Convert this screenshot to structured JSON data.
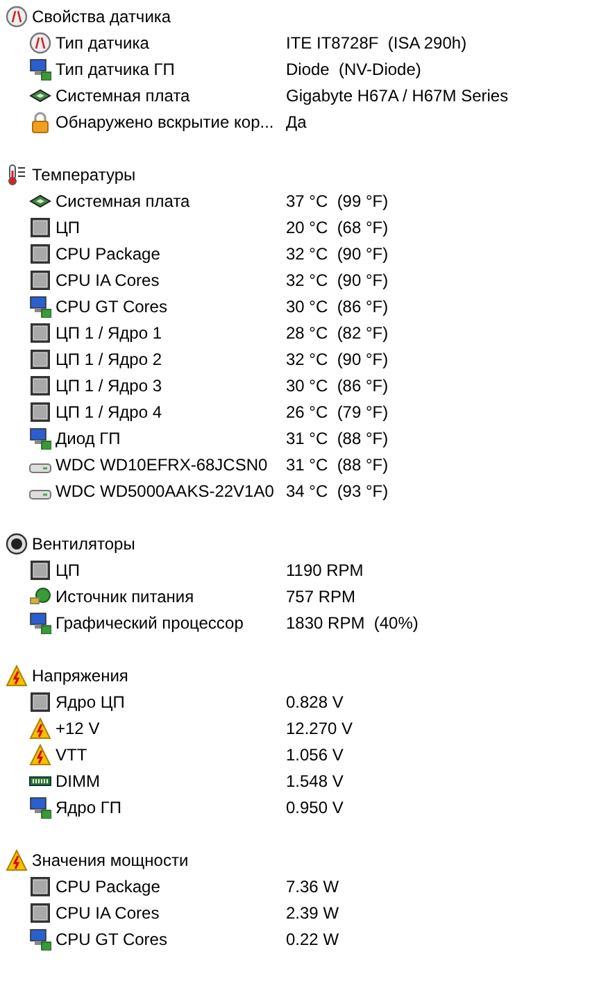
{
  "sections": [
    {
      "title": "Свойства датчика",
      "kind": "gauge",
      "items": [
        {
          "kind": "gauge",
          "label": "Тип датчика",
          "value": "ITE IT8728F  (ISA 290h)"
        },
        {
          "kind": "gpu",
          "label": "Тип датчика ГП",
          "value": "Diode  (NV-Diode)"
        },
        {
          "kind": "board",
          "label": "Системная плата",
          "value": "Gigabyte H67A / H67M Series"
        },
        {
          "kind": "lock",
          "label": "Обнаружено вскрытие кор...",
          "value": "Да"
        }
      ]
    },
    {
      "title": "Температуры",
      "kind": "thermo",
      "items": [
        {
          "kind": "board",
          "label": "Системная плата",
          "value": "37 °C  (99 °F)"
        },
        {
          "kind": "cpu",
          "label": "ЦП",
          "value": "20 °C  (68 °F)"
        },
        {
          "kind": "cpu",
          "label": "CPU Package",
          "value": "32 °C  (90 °F)"
        },
        {
          "kind": "cpu",
          "label": "CPU IA Cores",
          "value": "32 °C  (90 °F)"
        },
        {
          "kind": "gpu",
          "label": "CPU GT Cores",
          "value": "30 °C  (86 °F)"
        },
        {
          "kind": "cpu",
          "label": "ЦП 1 / Ядро 1",
          "value": "28 °C  (82 °F)"
        },
        {
          "kind": "cpu",
          "label": "ЦП 1 / Ядро 2",
          "value": "32 °C  (90 °F)"
        },
        {
          "kind": "cpu",
          "label": "ЦП 1 / Ядро 3",
          "value": "30 °C  (86 °F)"
        },
        {
          "kind": "cpu",
          "label": "ЦП 1 / Ядро 4",
          "value": "26 °C  (79 °F)"
        },
        {
          "kind": "gpu",
          "label": "Диод ГП",
          "value": "31 °C  (88 °F)"
        },
        {
          "kind": "hdd",
          "label": "WDC WD10EFRX-68JCSN0",
          "value": "31 °C  (88 °F)"
        },
        {
          "kind": "hdd",
          "label": "WDC WD5000AAKS-22V1A0",
          "value": "34 °C  (93 °F)"
        }
      ]
    },
    {
      "title": "Вентиляторы",
      "kind": "fan",
      "items": [
        {
          "kind": "cpu",
          "label": "ЦП",
          "value": "1190 RPM"
        },
        {
          "kind": "psu",
          "label": "Источник питания",
          "value": "757 RPM"
        },
        {
          "kind": "gpu",
          "label": "Графический процессор",
          "value": "1830 RPM  (40%)"
        }
      ]
    },
    {
      "title": "Напряжения",
      "kind": "warning",
      "items": [
        {
          "kind": "cpu",
          "label": "Ядро ЦП",
          "value": "0.828 V"
        },
        {
          "kind": "warning",
          "label": "+12 V",
          "value": "12.270 V"
        },
        {
          "kind": "warning",
          "label": "VTT",
          "value": "1.056 V"
        },
        {
          "kind": "ram",
          "label": "DIMM",
          "value": "1.548 V"
        },
        {
          "kind": "gpu",
          "label": "Ядро ГП",
          "value": "0.950 V"
        }
      ]
    },
    {
      "title": "Значения мощности",
      "kind": "warning",
      "items": [
        {
          "kind": "cpu",
          "label": "CPU Package",
          "value": "7.36 W"
        },
        {
          "kind": "cpu",
          "label": "CPU IA Cores",
          "value": "2.39 W"
        },
        {
          "kind": "gpu",
          "label": "CPU GT Cores",
          "value": "0.22 W"
        }
      ]
    }
  ]
}
